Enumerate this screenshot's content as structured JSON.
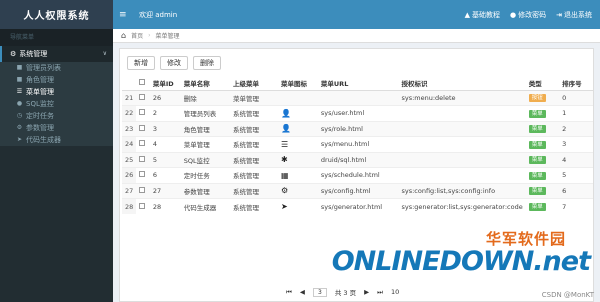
{
  "app": {
    "title": "人人权限系统"
  },
  "topbar": {
    "menu_toggle": "≡",
    "welcome": "欢迎 admin",
    "links": [
      {
        "icon": "▲",
        "label": "基础教程"
      },
      {
        "icon": "●",
        "label": "修改密码"
      },
      {
        "icon": "⇥",
        "label": "退出系统"
      }
    ]
  },
  "sidebar": {
    "header": "导航菜单",
    "group": {
      "icon": "⚙",
      "label": "系统管理",
      "chevron": "∨"
    },
    "items": [
      {
        "icon": "■",
        "label": "管理员列表"
      },
      {
        "icon": "■",
        "label": "角色管理"
      },
      {
        "icon": "☰",
        "label": "菜单管理"
      },
      {
        "icon": "●",
        "label": "SQL监控"
      },
      {
        "icon": "◷",
        "label": "定时任务"
      },
      {
        "icon": "⚙",
        "label": "参数管理"
      },
      {
        "icon": "➤",
        "label": "代码生成器"
      }
    ]
  },
  "breadcrumb": {
    "home": "⌂",
    "first": "首页",
    "sep": "›",
    "current": "菜单管理"
  },
  "toolbar": {
    "add": "新增",
    "edit": "修改",
    "delete": "删除"
  },
  "table": {
    "headers": [
      "",
      "菜单ID",
      "菜单名称",
      "上级菜单",
      "菜单图标",
      "菜单URL",
      "授权标识",
      "类型",
      "排序号"
    ],
    "rows": [
      {
        "n": "21",
        "id": "26",
        "name": "删除",
        "parent": "菜单管理",
        "icon": "",
        "url": "",
        "perms": "sys:menu:delete",
        "type": "按钮",
        "type_kind": "btn-type",
        "order": "0"
      },
      {
        "n": "22",
        "id": "2",
        "name": "管理员列表",
        "parent": "系统管理",
        "icon": "👤",
        "url": "sys/user.html",
        "perms": "",
        "type": "菜单",
        "type_kind": "menu",
        "order": "1"
      },
      {
        "n": "23",
        "id": "3",
        "name": "角色管理",
        "parent": "系统管理",
        "icon": "👤",
        "url": "sys/role.html",
        "perms": "",
        "type": "菜单",
        "type_kind": "menu",
        "order": "2"
      },
      {
        "n": "24",
        "id": "4",
        "name": "菜单管理",
        "parent": "系统管理",
        "icon": "☰",
        "url": "sys/menu.html",
        "perms": "",
        "type": "菜单",
        "type_kind": "menu",
        "order": "3"
      },
      {
        "n": "25",
        "id": "5",
        "name": "SQL监控",
        "parent": "系统管理",
        "icon": "✱",
        "url": "druid/sql.html",
        "perms": "",
        "type": "菜单",
        "type_kind": "menu",
        "order": "4"
      },
      {
        "n": "26",
        "id": "6",
        "name": "定时任务",
        "parent": "系统管理",
        "icon": "▦",
        "url": "sys/schedule.html",
        "perms": "",
        "type": "菜单",
        "type_kind": "menu",
        "order": "5"
      },
      {
        "n": "27",
        "id": "27",
        "name": "参数管理",
        "parent": "系统管理",
        "icon": "⚙",
        "url": "sys/config.html",
        "perms": "sys:config:list,sys:config:info",
        "type": "菜单",
        "type_kind": "menu",
        "order": "6"
      },
      {
        "n": "28",
        "id": "28",
        "name": "代码生成器",
        "parent": "系统管理",
        "icon": "➤",
        "url": "sys/generator.html",
        "perms": "sys:generator:list,sys:generator:code",
        "type": "菜单",
        "type_kind": "menu",
        "order": "7"
      }
    ]
  },
  "pager": {
    "first": "⏮",
    "prev": "◀",
    "page": "3",
    "total": "共 3 页",
    "next": "▶",
    "last": "⏭",
    "size": "10"
  },
  "watermark": {
    "cn": "华军软件园",
    "logo": "ONLINEDOWN.net",
    "credit": "CSDN @MonKT"
  }
}
